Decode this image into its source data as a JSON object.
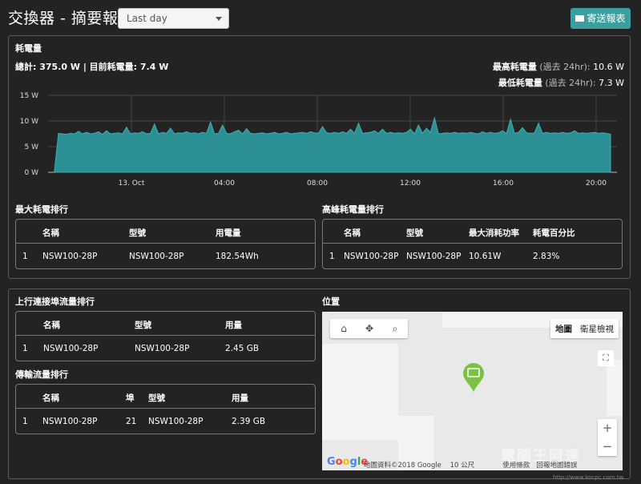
{
  "header": {
    "title": "交換器 - 摘要報表",
    "range_selected": "Last day",
    "send_report": "寄送報表"
  },
  "power": {
    "section_title": "耗電量",
    "summary": "總計: 375.0 W  |  目前耗電量: 7.4 W",
    "max_label": "最高耗電量",
    "max_period": "(過去 24hr):",
    "max_value": "10.6 W",
    "min_label": "最低耗電量",
    "min_period": "(過去 24hr):",
    "min_value": "7.3 W"
  },
  "chart_data": {
    "type": "area",
    "title": "",
    "xlabel": "",
    "ylabel": "",
    "ylim": [
      0,
      15
    ],
    "yticks": [
      "0 W",
      "5 W",
      "10 W",
      "15 W"
    ],
    "xticks": [
      "13. Oct",
      "04:00",
      "08:00",
      "12:00",
      "16:00",
      "20:00"
    ],
    "grid": true,
    "color": "#2b8f94",
    "series": [
      {
        "values": [
          0.3,
          7.6,
          7.5,
          7.4,
          7.6,
          7.5,
          8.0,
          7.5,
          7.8,
          7.5,
          7.6,
          7.9,
          7.4,
          8.1,
          7.5,
          7.6,
          7.7,
          7.5,
          8.8,
          7.5,
          7.7,
          7.6,
          7.9,
          7.5,
          7.6,
          9.4,
          7.5,
          7.8,
          7.6,
          8.6,
          7.5,
          7.7,
          7.6,
          7.9,
          7.6,
          7.7,
          7.5,
          7.8,
          7.6,
          9.8,
          7.5,
          7.6,
          9.2,
          7.6,
          7.5,
          7.9,
          8.2,
          7.5,
          8.5,
          7.6,
          7.5,
          7.6,
          7.7,
          7.5,
          7.6,
          7.8,
          7.5,
          7.6,
          7.8,
          7.5,
          7.6,
          7.7,
          7.8,
          7.6,
          7.9,
          7.7,
          7.6,
          8.9,
          7.7,
          7.6,
          7.8,
          7.6,
          7.9,
          7.6,
          8.4,
          7.6,
          9.6,
          7.6,
          7.7,
          7.8,
          8.1,
          7.6,
          8.4,
          7.6,
          7.8,
          7.6,
          7.7,
          7.6,
          7.8,
          8.4,
          7.5,
          9.2,
          7.6,
          8.6,
          7.8,
          10.6,
          7.5,
          7.6,
          7.7,
          7.6,
          7.8,
          7.6,
          7.7,
          7.6,
          7.8,
          7.6,
          7.5,
          7.9,
          7.6,
          7.8,
          7.6,
          7.7,
          8.1,
          7.6,
          10.3,
          7.6,
          7.8,
          8.7,
          7.7,
          7.6,
          7.7,
          9.6,
          7.6,
          7.8,
          7.6,
          7.7,
          7.6,
          7.8,
          7.6,
          7.7,
          8.1,
          7.6,
          7.7,
          7.6,
          7.7,
          7.8,
          7.6,
          7.7,
          7.6,
          7.4
        ]
      }
    ]
  },
  "max_power_rank": {
    "title": "最大耗電排行",
    "headers": [
      "名稱",
      "型號",
      "用電量"
    ],
    "rows": [
      {
        "rank": "1",
        "name": "NSW100-28P",
        "model": "NSW100-28P",
        "value": "182.54Wh"
      }
    ]
  },
  "peak_power_rank": {
    "title": "高峰耗電量排行",
    "headers": [
      "名稱",
      "型號",
      "最大消耗功率",
      "耗電百分比"
    ],
    "rows": [
      {
        "rank": "1",
        "name": "NSW100-28P",
        "model": "NSW100-28P",
        "max": "10.61W",
        "pct": "2.83%"
      }
    ]
  },
  "uplink_rank": {
    "title": "上行連接埠流量排行",
    "headers": [
      "名稱",
      "型號",
      "用量"
    ],
    "rows": [
      {
        "rank": "1",
        "name": "NSW100-28P",
        "model": "NSW100-28P",
        "usage": "2.45 GB"
      }
    ]
  },
  "transfer_rank": {
    "title": "傳輸流量排行",
    "headers": [
      "名稱",
      "埠",
      "型號",
      "用量"
    ],
    "rows": [
      {
        "rank": "1",
        "name": "NSW100-28P",
        "port": "21",
        "model": "NSW100-28P",
        "usage": "2.39 GB"
      }
    ]
  },
  "location": {
    "title": "位置",
    "map_type_map": "地圖",
    "map_type_satellite": "衛星檢視",
    "google": "Google",
    "map_data": "地圖資料©2018 Google",
    "scale": "10 公尺",
    "terms": "使用條款",
    "report": "回報地圖錯誤",
    "marker_color": "#7cc242"
  },
  "watermark": {
    "text": "電腦王阿達",
    "url": "http://www.kocpc.com.tw"
  }
}
